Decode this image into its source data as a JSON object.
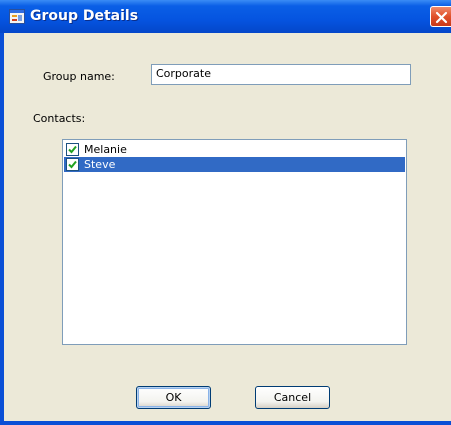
{
  "window": {
    "title": "Group Details",
    "colors": {
      "titlebar": "#0554e0",
      "client": "#ece9d8",
      "selection": "#316ac5",
      "close": "#e0502a"
    }
  },
  "icons": {
    "app": "form-window-icon",
    "close": "close-x-icon",
    "check": "checkmark-icon"
  },
  "form": {
    "group_name_label": "Group name:",
    "group_name_value": "Corporate",
    "contacts_label": "Contacts:"
  },
  "contacts": [
    {
      "name": "Melanie",
      "checked": true,
      "selected": false
    },
    {
      "name": "Steve",
      "checked": true,
      "selected": true
    }
  ],
  "buttons": {
    "ok": "OK",
    "cancel": "Cancel"
  }
}
